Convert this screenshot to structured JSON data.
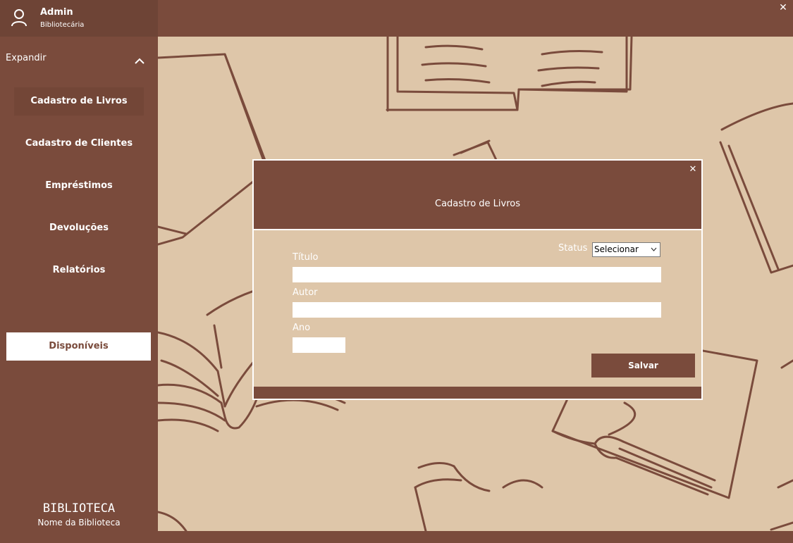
{
  "user": {
    "name": "Admin",
    "role": "Bibliotecária",
    "icon": "user-icon"
  },
  "window": {
    "close_glyph": "✕"
  },
  "sidebar": {
    "expand_label": "Expandir",
    "items": [
      {
        "label": "Cadastro de Livros",
        "active": true
      },
      {
        "label": "Cadastro de Clientes",
        "active": false
      },
      {
        "label": "Empréstimos",
        "active": false
      },
      {
        "label": "Devoluções",
        "active": false
      },
      {
        "label": "Relatórios",
        "active": false
      }
    ],
    "available_button": "Disponíveis",
    "brand_title": "BIBLIOTECA",
    "brand_subtitle": "Nome da Biblioteca"
  },
  "modal": {
    "title": "Cadastro de Livros",
    "close_glyph": "✕",
    "status_label": "Status",
    "status_selected": "Selecionar",
    "titulo_label": "Título",
    "titulo_value": "",
    "autor_label": "Autor",
    "autor_value": "",
    "ano_label": "Ano",
    "ano_value": "",
    "save_label": "Salvar"
  },
  "colors": {
    "primary": "#7a4b3c",
    "background": "#dec6a9",
    "white": "#ffffff"
  }
}
